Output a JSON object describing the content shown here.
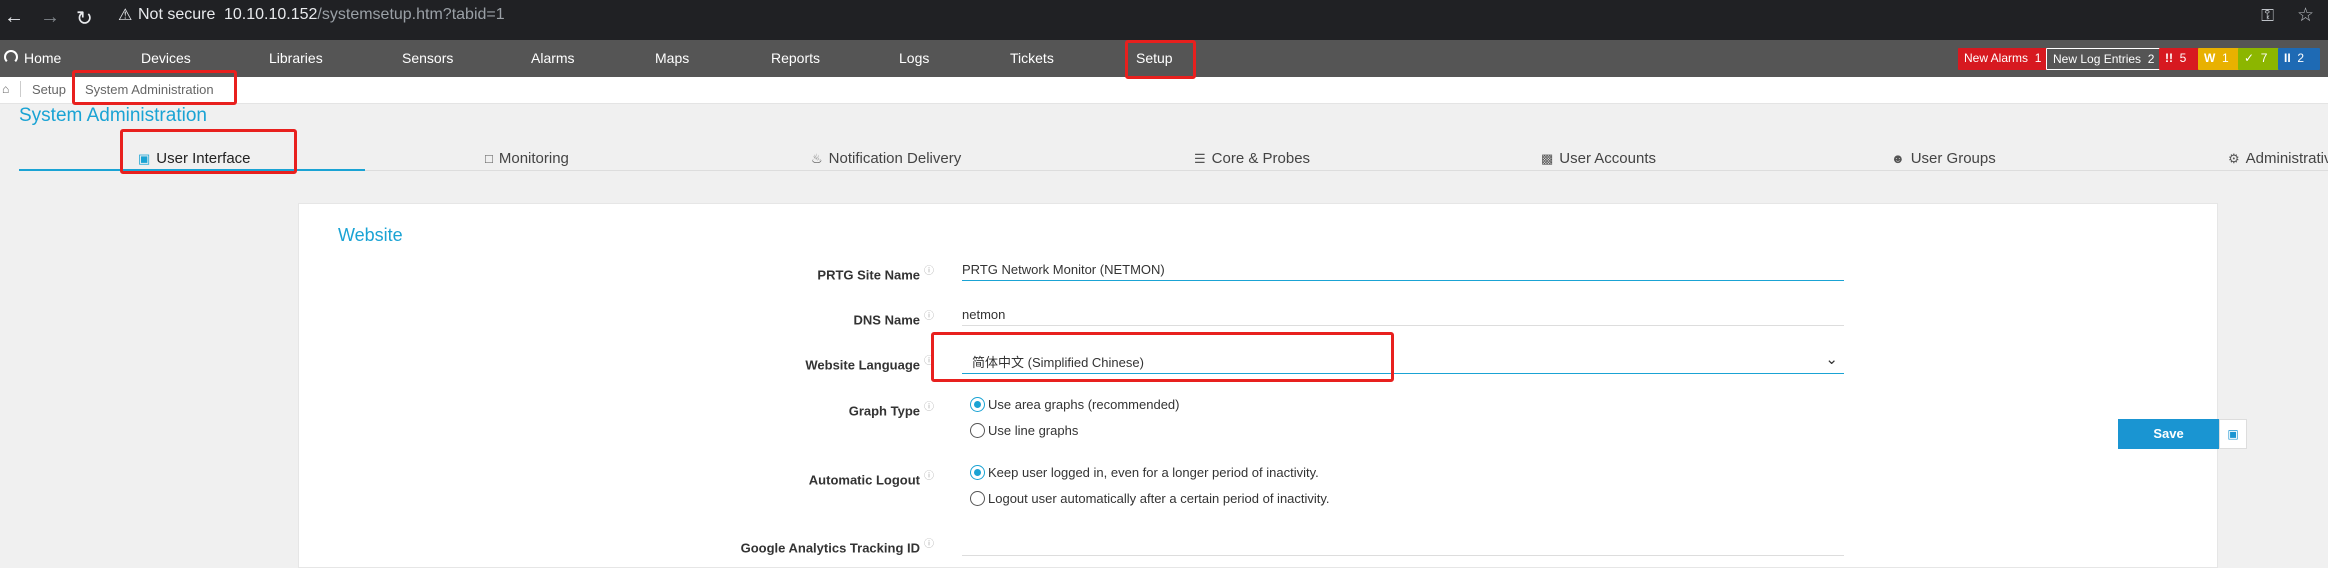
{
  "browser": {
    "security_label": "Not secure",
    "url_host": "10.10.10.152",
    "url_path": "/systemsetup.htm?tabid=1"
  },
  "nav": {
    "home": "Home",
    "items": [
      "Devices",
      "Libraries",
      "Sensors",
      "Alarms",
      "Maps",
      "Reports",
      "Logs",
      "Tickets",
      "Setup"
    ]
  },
  "badges": {
    "new_alarms_label": "New Alarms",
    "new_alarms_count": "1",
    "new_logs_label": "New Log Entries",
    "new_logs_count": "2",
    "down_icon": "!!",
    "down_count": "5",
    "warning_icon": "W",
    "warning_count": "1",
    "up_icon": "✓",
    "up_count": "7",
    "paused_icon": "II",
    "paused_count": "2",
    "colors": {
      "down": "#d71920",
      "warning": "#e8b100",
      "up": "#8cb600",
      "paused": "#1e6ab4"
    }
  },
  "breadcrumb": {
    "items": [
      "Setup",
      "System Administration"
    ]
  },
  "page_title": "System Administration",
  "tabs": [
    {
      "label": "User Interface",
      "icon": "monitor-icon",
      "active": true
    },
    {
      "label": "Monitoring",
      "icon": "laptop-icon"
    },
    {
      "label": "Notification Delivery",
      "icon": "bell-icon"
    },
    {
      "label": "Core & Probes",
      "icon": "server-icon"
    },
    {
      "label": "User Accounts",
      "icon": "id-card-icon"
    },
    {
      "label": "User Groups",
      "icon": "users-icon"
    },
    {
      "label": "Administrativ",
      "icon": "gears-icon"
    }
  ],
  "website": {
    "title": "Website",
    "site_name_label": "PRTG Site Name",
    "site_name_value": "PRTG Network Monitor (NETMON)",
    "dns_label": "DNS Name",
    "dns_value": "netmon",
    "language_label": "Website Language",
    "language_value": "简体中文 (Simplified Chinese)",
    "graph_type_label": "Graph Type",
    "graph_options": [
      "Use area graphs (recommended)",
      "Use line graphs"
    ],
    "logout_label": "Automatic Logout",
    "logout_options": [
      "Keep user logged in, even for a longer period of inactivity.",
      "Logout user automatically after a certain period of inactivity."
    ],
    "ga_label": "Google Analytics Tracking ID",
    "ga_value": ""
  },
  "save_label": "Save",
  "accent_color": "#1aa3d4",
  "highlight_color": "#e8201e"
}
